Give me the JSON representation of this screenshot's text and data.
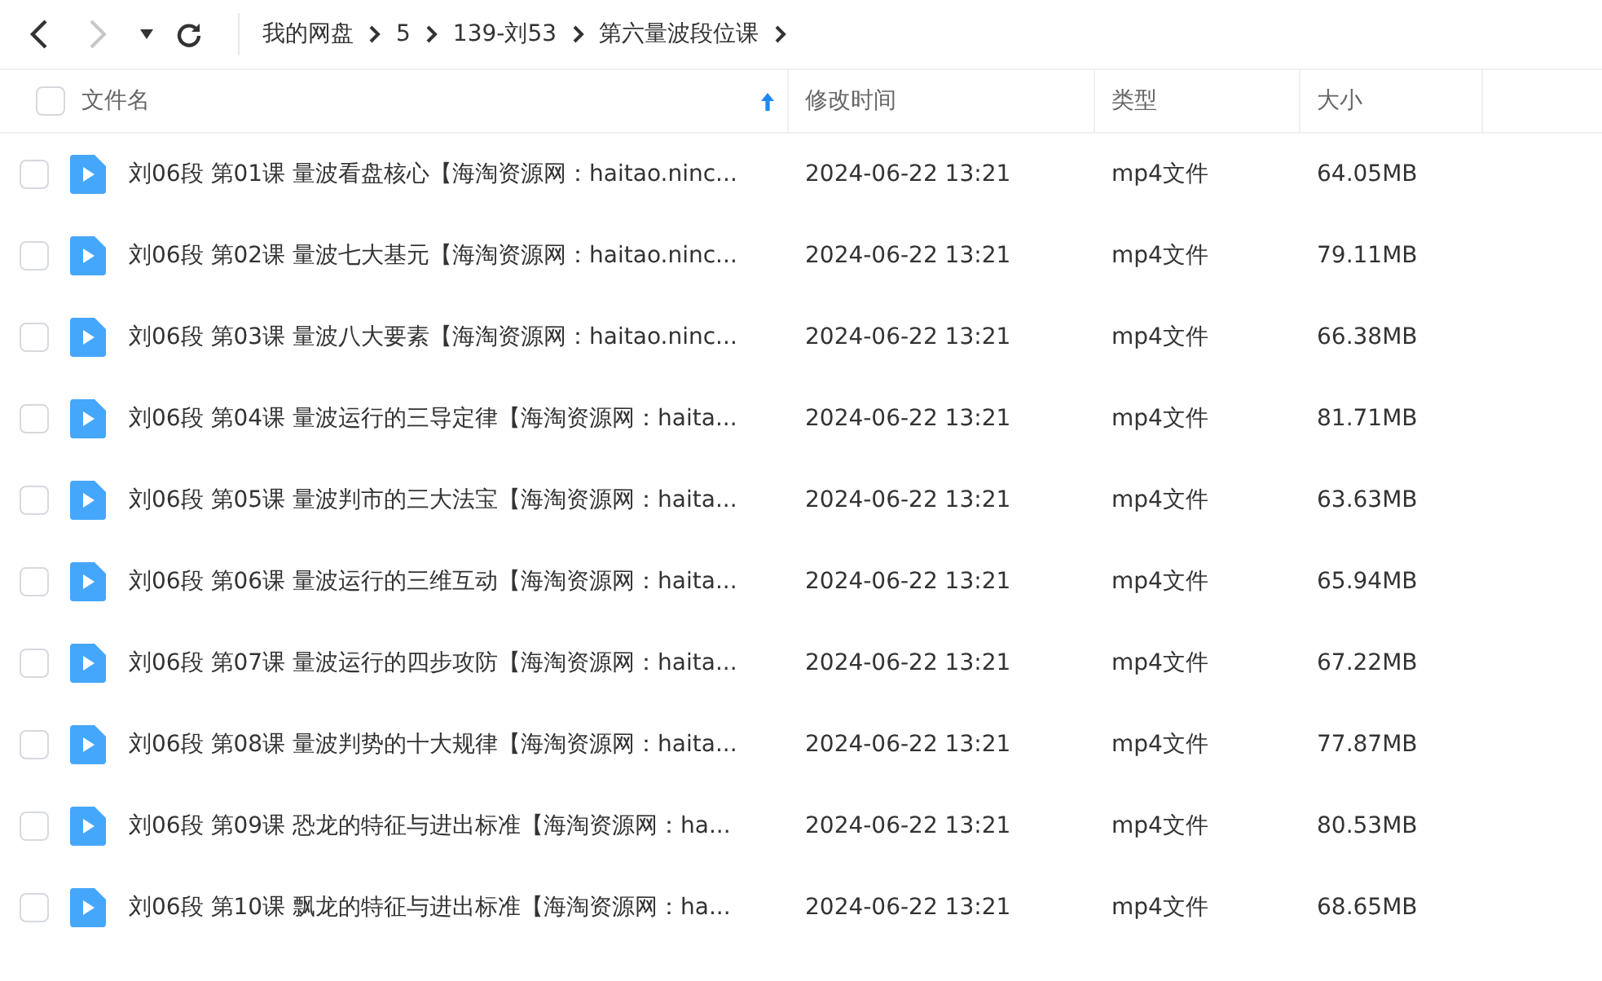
{
  "toolbar": {
    "back": {
      "disabled": false
    },
    "forward": {
      "disabled": true
    }
  },
  "breadcrumb": [
    "我的网盘",
    "5",
    "139-刘53",
    "第六量波段位课"
  ],
  "table": {
    "columns": [
      {
        "label": "文件名",
        "sorted": true
      },
      {
        "label": "修改时间",
        "sorted": false
      },
      {
        "label": "类型",
        "sorted": false
      },
      {
        "label": "大小",
        "sorted": false
      }
    ],
    "select_all": {
      "checked": false
    },
    "rows": [
      {
        "name": "刘06段 第01课 量波看盘核心【海淘资源网：haitao.ninc...",
        "modified": "2024-06-22 13:21",
        "type": "mp4文件",
        "size": "64.05MB",
        "checked": false
      },
      {
        "name": "刘06段 第02课 量波七大基元【海淘资源网：haitao.ninc...",
        "modified": "2024-06-22 13:21",
        "type": "mp4文件",
        "size": "79.11MB",
        "checked": false
      },
      {
        "name": "刘06段 第03课 量波八大要素【海淘资源网：haitao.ninc...",
        "modified": "2024-06-22 13:21",
        "type": "mp4文件",
        "size": "66.38MB",
        "checked": false
      },
      {
        "name": "刘06段 第04课 量波运行的三导定律【海淘资源网：haita...",
        "modified": "2024-06-22 13:21",
        "type": "mp4文件",
        "size": "81.71MB",
        "checked": false
      },
      {
        "name": "刘06段 第05课 量波判市的三大法宝【海淘资源网：haita...",
        "modified": "2024-06-22 13:21",
        "type": "mp4文件",
        "size": "63.63MB",
        "checked": false
      },
      {
        "name": "刘06段 第06课 量波运行的三维互动【海淘资源网：haita...",
        "modified": "2024-06-22 13:21",
        "type": "mp4文件",
        "size": "65.94MB",
        "checked": false
      },
      {
        "name": "刘06段 第07课 量波运行的四步攻防【海淘资源网：haita...",
        "modified": "2024-06-22 13:21",
        "type": "mp4文件",
        "size": "67.22MB",
        "checked": false
      },
      {
        "name": "刘06段 第08课 量波判势的十大规律【海淘资源网：haita...",
        "modified": "2024-06-22 13:21",
        "type": "mp4文件",
        "size": "77.87MB",
        "checked": false
      },
      {
        "name": "刘06段 第09课 恐龙的特征与进出标准【海淘资源网：ha...",
        "modified": "2024-06-22 13:21",
        "type": "mp4文件",
        "size": "80.53MB",
        "checked": false
      },
      {
        "name": "刘06段 第10课 飘龙的特征与进出标准【海淘资源网：ha...",
        "modified": "2024-06-22 13:21",
        "type": "mp4文件",
        "size": "68.65MB",
        "checked": false
      }
    ]
  }
}
